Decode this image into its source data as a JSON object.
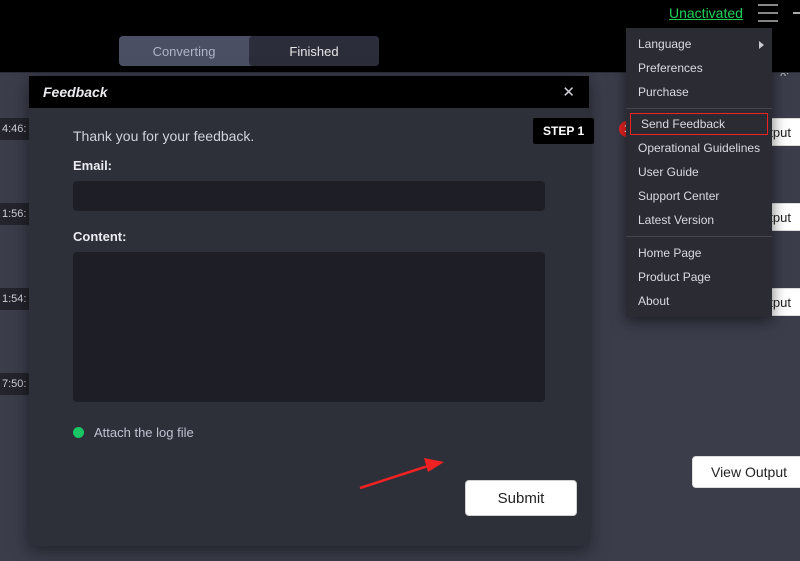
{
  "topbar": {
    "unactivated": "Unactivated",
    "to_label": "o:"
  },
  "tabs": {
    "converting": "Converting",
    "finished": "Finished"
  },
  "rows": {
    "t1": "4:46:",
    "t2": "1:56:",
    "t3": "1:54:",
    "t4": "7:50:",
    "output_btn": "utput",
    "view_output": "View Output"
  },
  "dialog": {
    "title": "Feedback",
    "thanks": "Thank you for your feedback.",
    "email_label": "Email:",
    "content_label": "Content:",
    "attach": "Attach the log file",
    "submit": "Submit"
  },
  "callouts": {
    "step1": "STEP 1",
    "badge_num": "1"
  },
  "menu": {
    "language": "Language",
    "preferences": "Preferences",
    "purchase": "Purchase",
    "send_feedback": "Send Feedback",
    "guidelines": "Operational Guidelines",
    "user_guide": "User Guide",
    "support": "Support Center",
    "latest": "Latest Version",
    "home": "Home Page",
    "product": "Product Page",
    "about": "About"
  }
}
